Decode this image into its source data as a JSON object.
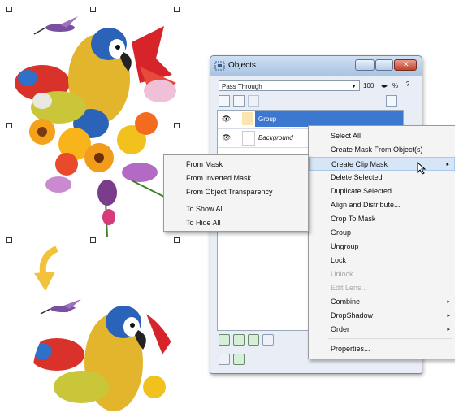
{
  "objects_window": {
    "title": "Objects",
    "blend_mode": "Pass Through",
    "opacity_value": "100",
    "opacity_unit": "%",
    "layers": [
      {
        "name": "Group",
        "selected": true
      },
      {
        "name": "Background",
        "selected": false
      }
    ]
  },
  "context_menu": {
    "items": [
      {
        "label": "Select All",
        "enabled": true,
        "submenu": false
      },
      {
        "label": "Create Mask From Object(s)",
        "enabled": true,
        "submenu": false
      },
      {
        "label": "Create Clip Mask",
        "enabled": true,
        "submenu": true,
        "highlighted": true
      },
      {
        "label": "Delete Selected",
        "enabled": true,
        "submenu": false
      },
      {
        "label": "Duplicate Selected",
        "enabled": true,
        "submenu": false
      },
      {
        "label": "Align and Distribute...",
        "enabled": true,
        "submenu": false
      },
      {
        "label": "Crop To Mask",
        "enabled": true,
        "submenu": false
      },
      {
        "label": "Group",
        "enabled": true,
        "submenu": false
      },
      {
        "label": "Ungroup",
        "enabled": true,
        "submenu": false
      },
      {
        "label": "Lock",
        "enabled": true,
        "submenu": false
      },
      {
        "label": "Unlock",
        "enabled": false,
        "submenu": false
      },
      {
        "label": "Edit Lens...",
        "enabled": false,
        "submenu": false
      },
      {
        "label": "Combine",
        "enabled": true,
        "submenu": true
      },
      {
        "label": "DropShadow",
        "enabled": true,
        "submenu": true
      },
      {
        "label": "Order",
        "enabled": true,
        "submenu": true
      },
      {
        "label": "Properties...",
        "enabled": true,
        "submenu": false
      }
    ]
  },
  "submenu": {
    "items": [
      {
        "label": "From Mask"
      },
      {
        "label": "From Inverted Mask"
      },
      {
        "label": "From Object Transparency"
      },
      {
        "label": "To Show All"
      },
      {
        "label": "To Hide All"
      }
    ]
  },
  "colors": {
    "selection": "#3c78d0",
    "menu_highlight": "#d6e6f7",
    "arrow": "#f2c23a"
  }
}
